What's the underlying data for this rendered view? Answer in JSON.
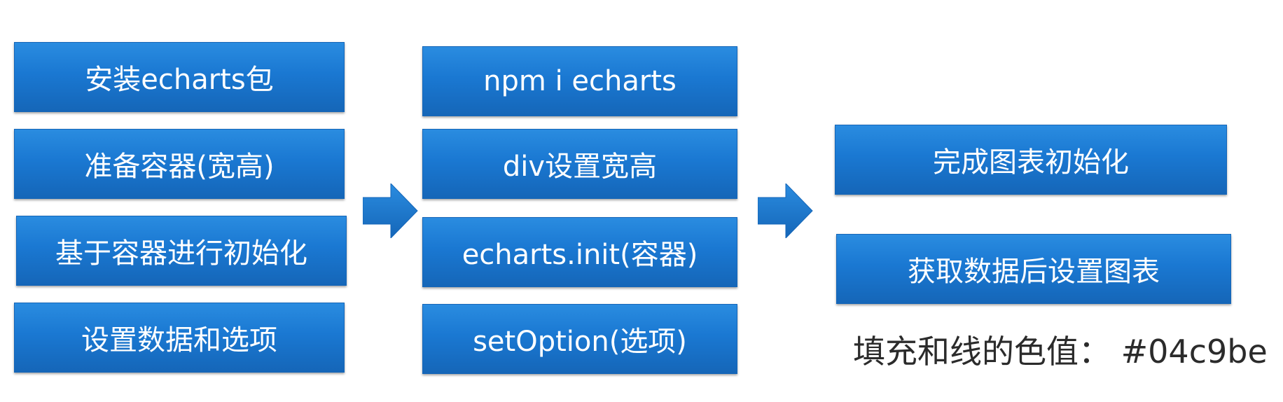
{
  "colors": {
    "box_fill": "#04c9be",
    "box_fill_rendered": "#1a78d2"
  },
  "column1": {
    "items": [
      {
        "label": "安装echarts包"
      },
      {
        "label": "准备容器(宽高)"
      },
      {
        "label": "基于容器进行初始化"
      },
      {
        "label": "设置数据和选项"
      }
    ]
  },
  "column2": {
    "items": [
      {
        "label": "npm i echarts"
      },
      {
        "label": "div设置宽高"
      },
      {
        "label": "echarts.init(容器)"
      },
      {
        "label": "setOption(选项)"
      }
    ]
  },
  "column3": {
    "items": [
      {
        "label": "完成图表初始化"
      },
      {
        "label": "获取数据后设置图表"
      }
    ]
  },
  "note": {
    "text": "填充和线的色值： #04c9be"
  }
}
